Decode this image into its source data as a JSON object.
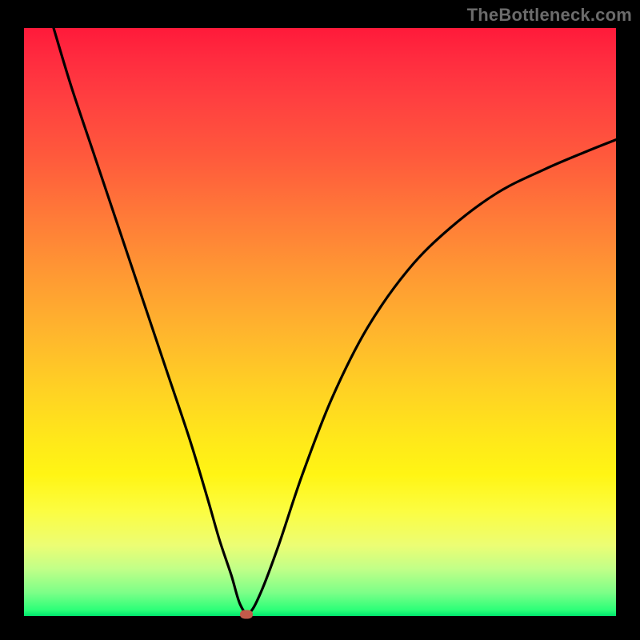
{
  "watermark": "TheBottleneck.com",
  "colors": {
    "frame": "#000000",
    "curve": "#000000",
    "marker": "#c45a4a",
    "gradient_stops": [
      {
        "pos": 0.0,
        "color": "#ff1a3a"
      },
      {
        "pos": 0.5,
        "color": "#ffc927"
      },
      {
        "pos": 0.8,
        "color": "#f8fd3a"
      },
      {
        "pos": 1.0,
        "color": "#00e56e"
      }
    ]
  },
  "chart_data": {
    "type": "line",
    "title": "",
    "xlabel": "",
    "ylabel": "",
    "xlim": [
      0,
      100
    ],
    "ylim": [
      0,
      100
    ],
    "grid": false,
    "legend": false,
    "series": [
      {
        "name": "curve",
        "x": [
          5,
          8,
          12,
          16,
          20,
          24,
          28,
          31,
          33,
          35,
          36.5,
          38,
          40,
          43,
          47,
          52,
          58,
          65,
          72,
          80,
          88,
          95,
          100
        ],
        "y": [
          100,
          90,
          78,
          66,
          54,
          42,
          30,
          20,
          13,
          7,
          2,
          0.5,
          4,
          12,
          24,
          37,
          49,
          59,
          66,
          72,
          76,
          79,
          81
        ]
      }
    ],
    "notch": {
      "x": 37.5,
      "y": 0.3
    },
    "interpretation": "V-shaped curve with minimum near x≈37.5 over a vertical red-to-green gradient background"
  }
}
